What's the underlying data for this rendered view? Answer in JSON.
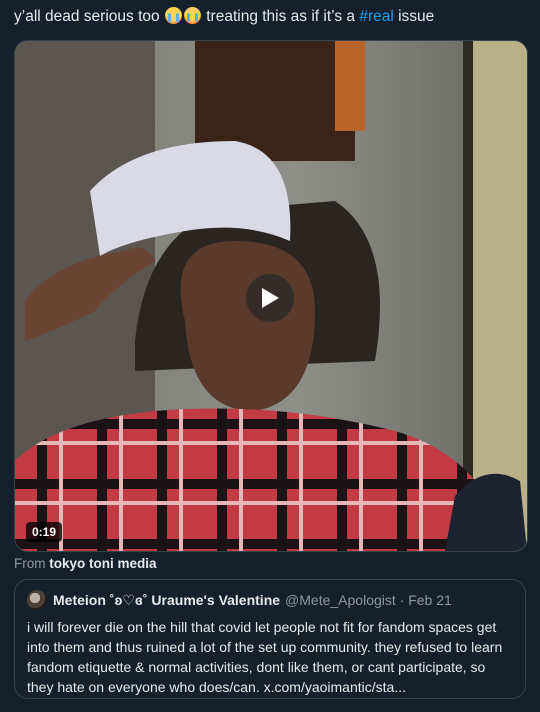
{
  "tweet": {
    "text_before": "y’all dead serious too",
    "emoji": [
      "loudly-crying-face",
      "loudly-crying-face"
    ],
    "text_middle": "treating this as if it’s a",
    "hashtag": "#real",
    "text_after": "issue"
  },
  "video": {
    "duration": "0:19",
    "play_icon": "play-icon"
  },
  "source": {
    "prefix": "From",
    "name": "tokyo toni media"
  },
  "quote": {
    "display_name": "Meteion ˚ʚ♡ɞ˚ Uraume's Valentine",
    "handle_date": "@Mete_Apologist · Feb 21",
    "body": "i will forever die on the hill that covid let people not fit for fandom spaces get into them and thus ruined a lot of the set up community. they refused to learn fandom etiquette & normal activities, dont like them, or cant participate, so they hate on everyone who does/can. x.com/yaoimantic/sta..."
  },
  "colors": {
    "background": "#15202b",
    "text": "#e7e9ea",
    "muted": "#8b98a5",
    "accent": "#1d9bf0",
    "border": "#38444d"
  }
}
